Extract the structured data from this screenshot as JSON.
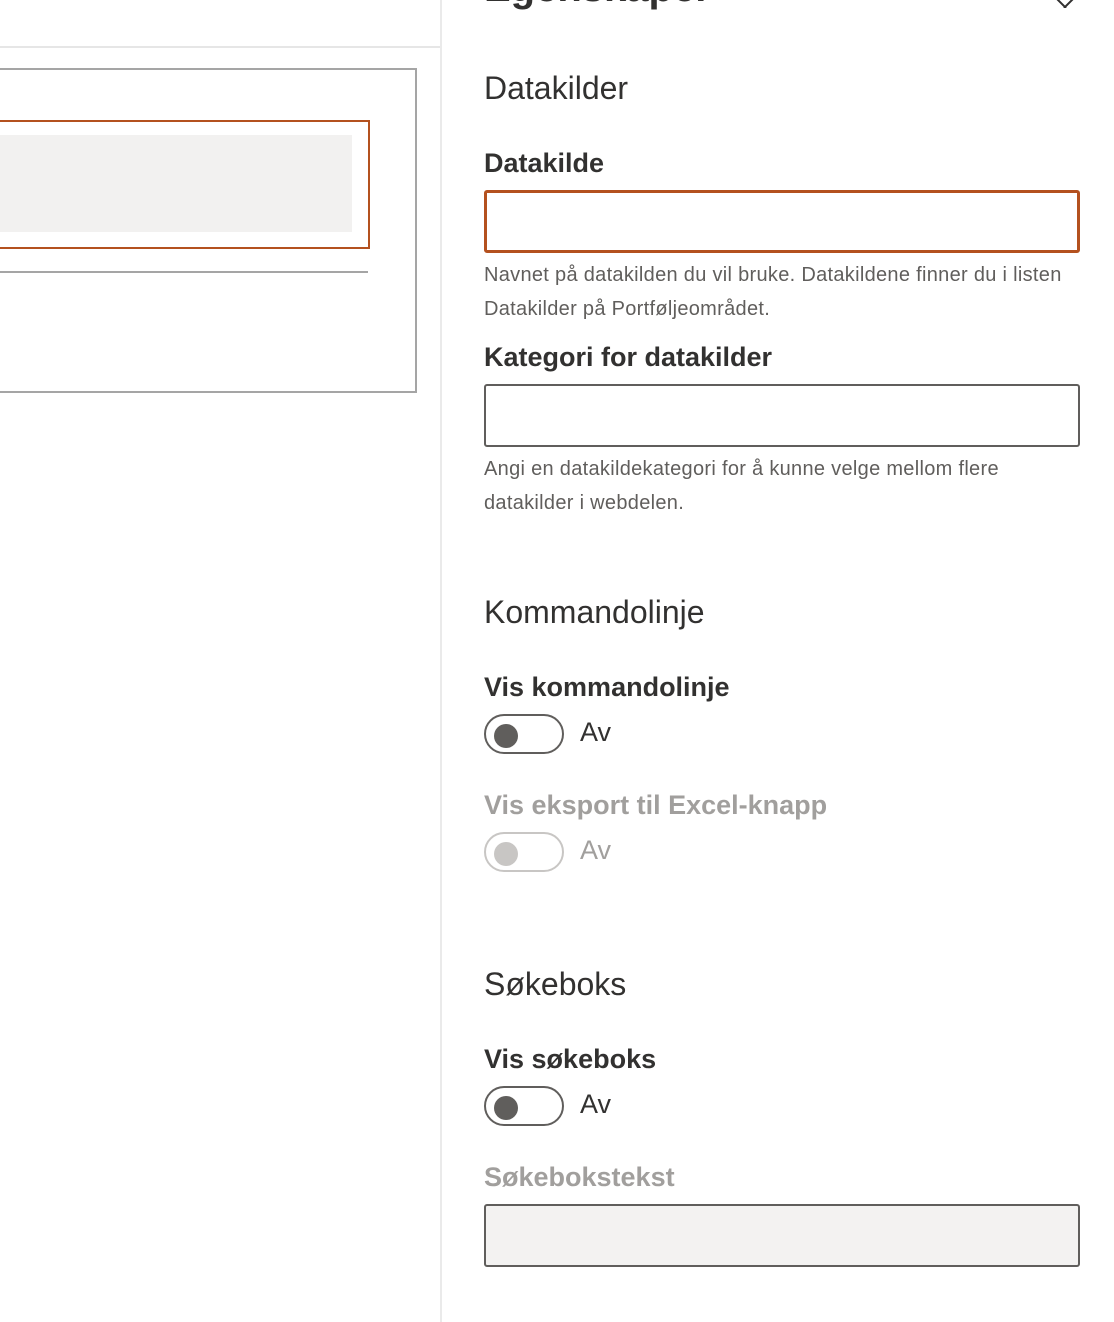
{
  "pane": {
    "title": "Egenskaper",
    "datasource_section": {
      "title": "Datakilder",
      "datasource_label": "Datakilde",
      "datasource_value": "",
      "datasource_help": "Navnet på datakilden du vil bruke. Datakildene finner du i listen Datakilder på Portføljeområdet.",
      "category_label": "Kategori for datakilder",
      "category_value": "",
      "category_help": "Angi en datakildekategori for å kunne velge mellom flere datakilder i webdelen."
    },
    "command_section": {
      "title": "Kommandolinje",
      "show_command_label": "Vis kommandolinje",
      "show_command_state": "Av",
      "show_export_label": "Vis eksport til Excel-knapp",
      "show_export_state": "Av"
    },
    "search_section": {
      "title": "Søkeboks",
      "show_search_label": "Vis søkeboks",
      "show_search_state": "Av",
      "search_text_label": "Søkebokstekst",
      "search_text_value": ""
    }
  },
  "colors": {
    "accent": "#b4511f",
    "text": "#323130",
    "disabled_text": "#a19f9d",
    "help_text": "#605e5c"
  }
}
